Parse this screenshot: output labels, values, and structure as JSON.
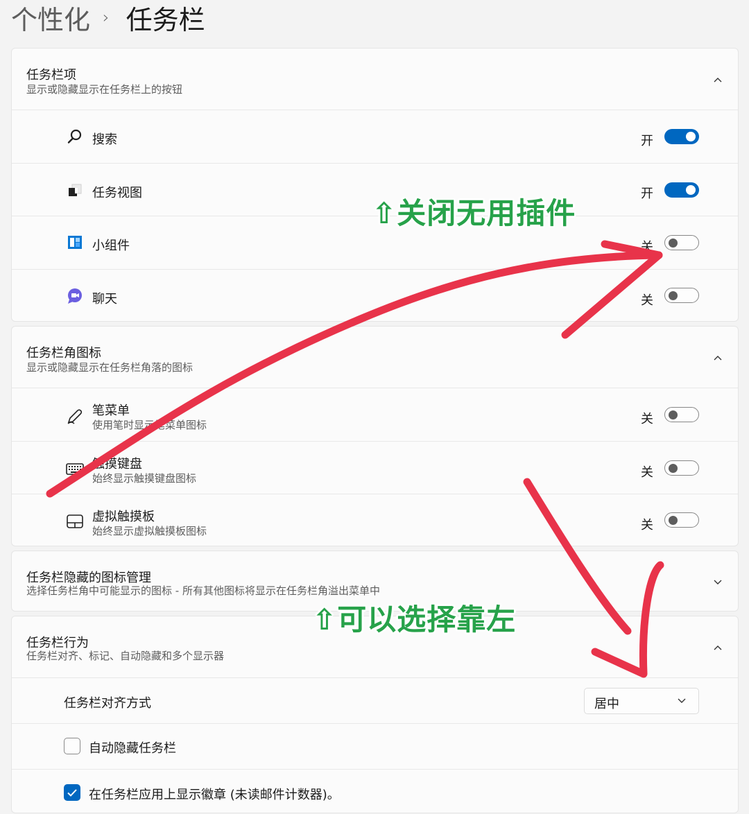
{
  "breadcrumb": {
    "parent": "个性化",
    "separator": "›",
    "current": "任务栏"
  },
  "taskbar_items": {
    "title": "任务栏项",
    "subtitle": "显示或隐藏显示在任务栏上的按钮",
    "items": [
      {
        "label": "搜索",
        "state": "开",
        "on": true,
        "icon": "search-icon"
      },
      {
        "label": "任务视图",
        "state": "开",
        "on": true,
        "icon": "task-view-icon"
      },
      {
        "label": "小组件",
        "state": "关",
        "on": false,
        "icon": "widgets-icon"
      },
      {
        "label": "聊天",
        "state": "关",
        "on": false,
        "icon": "chat-icon"
      }
    ]
  },
  "corner_icons": {
    "title": "任务栏角图标",
    "subtitle": "显示或隐藏显示在任务栏角落的图标",
    "items": [
      {
        "label": "笔菜单",
        "sub": "使用笔时显示笔菜单图标",
        "state": "关",
        "on": false,
        "icon": "pen-icon"
      },
      {
        "label": "触摸键盘",
        "sub": "始终显示触摸键盘图标",
        "state": "关",
        "on": false,
        "icon": "keyboard-icon"
      },
      {
        "label": "虚拟触摸板",
        "sub": "始终显示虚拟触摸板图标",
        "state": "关",
        "on": false,
        "icon": "touchpad-icon"
      }
    ]
  },
  "overflow": {
    "title": "任务栏隐藏的图标管理",
    "subtitle": "选择任务栏角中可能显示的图标 - 所有其他图标将显示在任务栏角溢出菜单中"
  },
  "behaviors": {
    "title": "任务栏行为",
    "subtitle": "任务栏对齐、标记、自动隐藏和多个显示器",
    "alignment_label": "任务栏对齐方式",
    "alignment_value": "居中",
    "auto_hide_label": "自动隐藏任务栏",
    "auto_hide_checked": false,
    "badges_label": "在任务栏应用上显示徽章 (未读邮件计数器)。",
    "badges_checked": true
  },
  "annotations": {
    "top": "关闭无用插件",
    "bottom": "可以选择靠左",
    "arrow_color": "#e8334a",
    "text_color": "#27a24a"
  },
  "colors": {
    "accent": "#0067c0",
    "background": "#f3f3f3",
    "card": "#fbfbfb"
  }
}
